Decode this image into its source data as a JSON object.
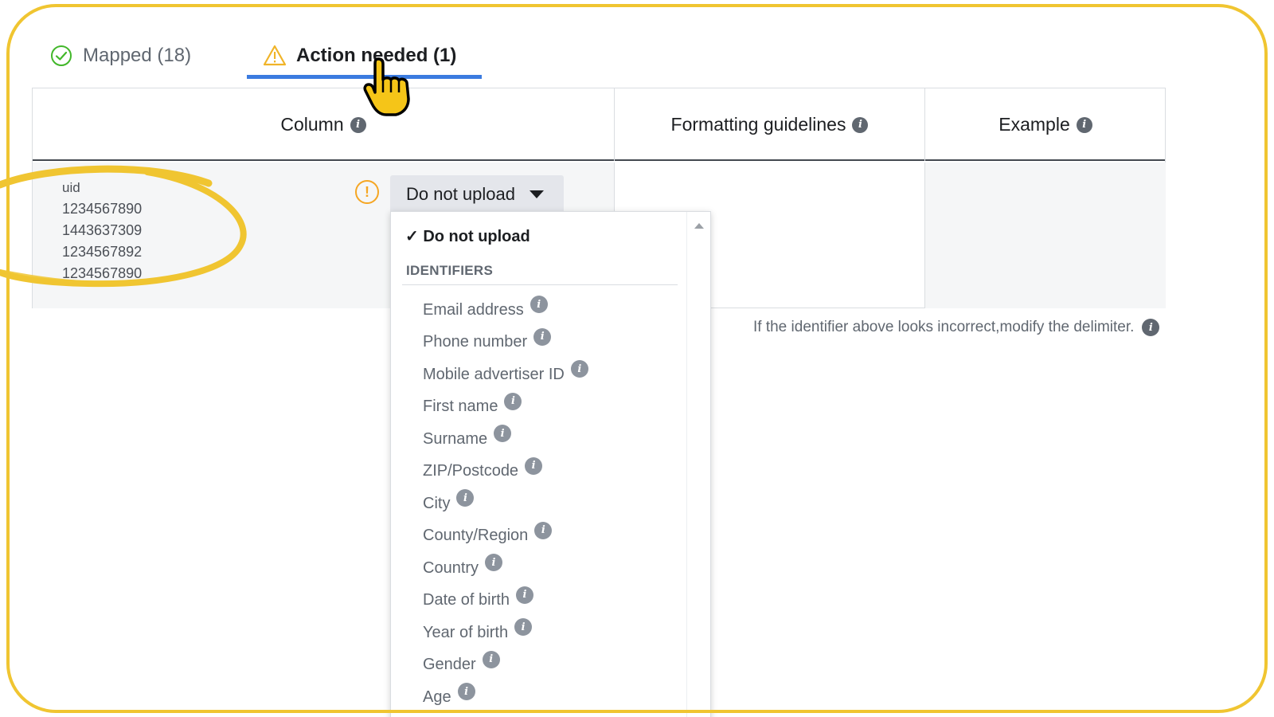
{
  "tabs": [
    {
      "label": "Mapped (18)",
      "icon": "check-circle-icon",
      "active": false
    },
    {
      "label": "Action needed (1)",
      "icon": "warning-triangle-icon",
      "active": true
    }
  ],
  "table": {
    "headers": [
      "Column",
      "Formatting guidelines",
      "Example"
    ],
    "sample_column": {
      "header": "uid",
      "values": [
        "1234567890",
        "1443637309",
        "1234567892",
        "1234567890"
      ]
    },
    "select_value": "Do not upload"
  },
  "hint": {
    "text": "If the identifier above looks incorrect, ",
    "link": "modify the delimiter."
  },
  "dropdown": {
    "selected": "Do not upload",
    "section": "IDENTIFIERS",
    "items": [
      "Email address",
      "Phone number",
      "Mobile advertiser ID",
      "First name",
      "Surname",
      "ZIP/Postcode",
      "City",
      "County/Region",
      "Country",
      "Date of birth",
      "Year of birth",
      "Gender",
      "Age"
    ]
  },
  "colors": {
    "accent": "#3b7be0",
    "annotation": "#f0c531",
    "warning": "#f5a623",
    "success": "#42b72a"
  }
}
